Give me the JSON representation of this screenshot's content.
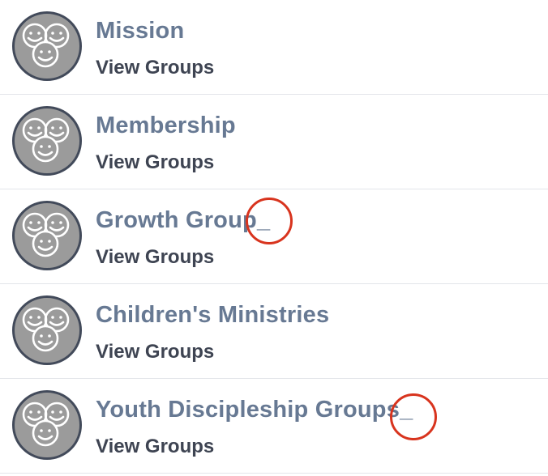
{
  "groups": [
    {
      "name": "Mission",
      "suffix": "",
      "subtitle": "View Groups",
      "icon": "people-group-icon"
    },
    {
      "name": "Membership",
      "suffix": "",
      "subtitle": "View Groups",
      "icon": "people-group-icon"
    },
    {
      "name": "Growth Group",
      "suffix": "_",
      "subtitle": "View Groups",
      "icon": "people-group-icon"
    },
    {
      "name": "Children's Ministries",
      "suffix": "",
      "subtitle": "View Groups",
      "icon": "people-group-icon"
    },
    {
      "name": "Youth Discipleship Groups",
      "suffix": "_",
      "subtitle": "View Groups",
      "icon": "people-group-icon"
    }
  ],
  "colors": {
    "title": "#677993",
    "subtitle": "#3e4452",
    "avatar_bg": "#9b9b9b",
    "avatar_border": "#424a5a",
    "annotation": "#d8341e",
    "divider": "#e3e5ea"
  }
}
